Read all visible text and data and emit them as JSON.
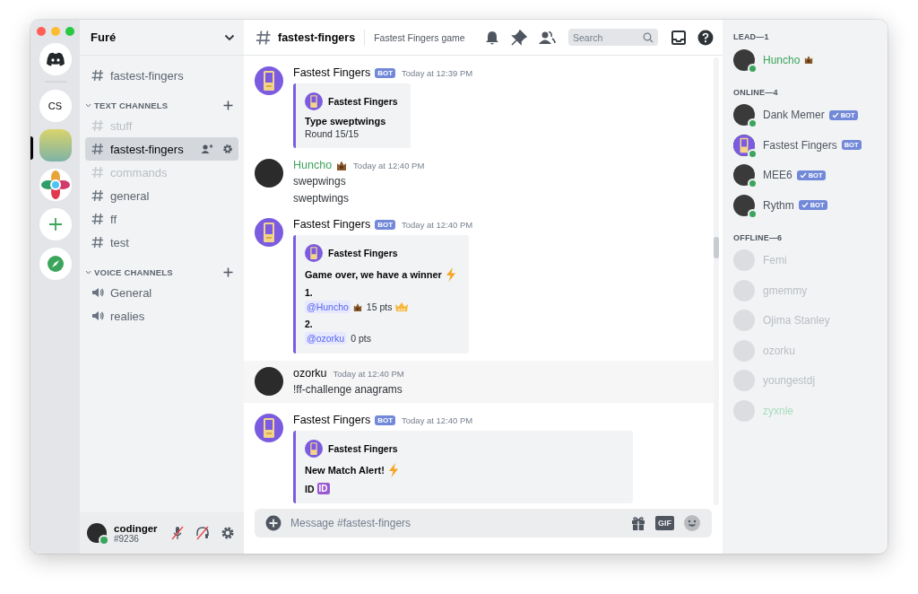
{
  "window": {
    "controls": [
      {
        "kind": "close"
      },
      {
        "kind": "minimize"
      },
      {
        "kind": "zoom"
      }
    ]
  },
  "servers": [
    {
      "kind": "logo",
      "selected": false
    },
    {
      "kind": "text",
      "label": "CS",
      "selected": false
    },
    {
      "kind": "photo",
      "selected": true
    },
    {
      "kind": "atom",
      "selected": false
    },
    {
      "kind": "add",
      "selected": false
    },
    {
      "kind": "explore",
      "selected": false
    }
  ],
  "server_name": "Furé",
  "pinned_channel": {
    "name": "fastest-fingers"
  },
  "categories": [
    {
      "label": "TEXT CHANNELS",
      "kind": "text",
      "channels": [
        {
          "name": "stuff",
          "selected": false,
          "muted": true
        },
        {
          "name": "fastest-fingers",
          "selected": true,
          "muted": false
        },
        {
          "name": "commands",
          "selected": false,
          "muted": true
        },
        {
          "name": "general",
          "selected": false,
          "muted": false
        },
        {
          "name": "ff",
          "selected": false,
          "muted": false
        },
        {
          "name": "test",
          "selected": false,
          "muted": false
        }
      ]
    },
    {
      "label": "VOICE CHANNELS",
      "kind": "voice",
      "channels": [
        {
          "name": "General",
          "selected": false,
          "muted": false
        },
        {
          "name": "realies",
          "selected": false,
          "muted": false
        }
      ]
    }
  ],
  "user": {
    "name": "codinger",
    "tag": "#9236",
    "online": true
  },
  "channel_header": {
    "name": "fastest-fingers",
    "topic": "Fastest Fingers game",
    "search": {
      "placeholder": "Search"
    }
  },
  "messages": [
    {
      "author": "Fastest Fingers",
      "color": "#060607",
      "emoji": false,
      "badge": "BOT",
      "time": "Today at 12:39 PM",
      "highlighted": false,
      "embed": {
        "author": "Fastest Fingers",
        "wide": false,
        "blocks": [
          {
            "kind": "title",
            "text": "Type sweptwings",
            "lightning": false
          },
          {
            "kind": "text",
            "text": "Round 15/15"
          }
        ]
      }
    },
    {
      "author": "Huncho",
      "color": "#3ba55c",
      "emoji": true,
      "time": "Today at 12:40 PM",
      "highlighted": false,
      "lines": [
        "swepwings",
        "sweptwings"
      ]
    },
    {
      "author": "Fastest Fingers",
      "color": "#060607",
      "emoji": false,
      "badge": "BOT",
      "time": "Today at 12:40 PM",
      "highlighted": false,
      "embed": {
        "author": "Fastest Fingers",
        "wide": false,
        "blocks": [
          {
            "kind": "title",
            "text": "Game over, we have a winner",
            "lightning": true
          },
          {
            "kind": "rank",
            "place": "1.",
            "mention": "@Huncho",
            "emoji": true,
            "points": "15 pts",
            "crown": true
          },
          {
            "kind": "rank",
            "place": "2.",
            "mention": "@ozorku",
            "emoji": false,
            "points": "0 pts",
            "crown": false
          }
        ]
      }
    },
    {
      "author": "ozorku",
      "color": "#060607",
      "emoji": false,
      "time": "Today at 12:40 PM",
      "highlighted": true,
      "lines": [
        "!ff-challenge anagrams"
      ]
    },
    {
      "author": "Fastest Fingers",
      "color": "#060607",
      "emoji": false,
      "badge": "BOT",
      "time": "Today at 12:40 PM",
      "highlighted": false,
      "embed": {
        "author": "Fastest Fingers",
        "wide": true,
        "blocks": [
          {
            "kind": "title",
            "text": "New Match Alert!",
            "lightning": true
          },
          {
            "kind": "id",
            "label": "ID",
            "badge": "ID"
          }
        ]
      }
    }
  ],
  "composer": {
    "placeholder": "Message #fastest-fingers",
    "gif_label": "GIF"
  },
  "member_groups": [
    {
      "label": "LEAD—1",
      "members": [
        {
          "name": "Huncho",
          "color": "#3ba55c",
          "emoji": true,
          "online": true
        }
      ]
    },
    {
      "label": "ONLINE—4",
      "members": [
        {
          "name": "Dank Memer",
          "color": "#4f5660",
          "badge": "BOT",
          "verified": true,
          "online": true
        },
        {
          "name": "Fastest Fingers",
          "color": "#4f5660",
          "badge": "BOT",
          "verified": false,
          "online": true
        },
        {
          "name": "MEE6",
          "color": "#4f5660",
          "badge": "BOT",
          "verified": true,
          "online": true
        },
        {
          "name": "Rythm",
          "color": "#4f5660",
          "badge": "BOT",
          "verified": true,
          "online": true
        }
      ]
    },
    {
      "label": "OFFLINE—6",
      "members": [
        {
          "name": "Femi",
          "color": "#b9bec4",
          "online": false
        },
        {
          "name": "gmemmy",
          "color": "#b9bec4",
          "online": false
        },
        {
          "name": "Ojima Stanley",
          "color": "#b9bec4",
          "online": false
        },
        {
          "name": "ozorku",
          "color": "#b9bec4",
          "online": false
        },
        {
          "name": "youngestdj",
          "color": "#b9bec4",
          "online": false
        },
        {
          "name": "zyxnle",
          "color": "#a8dcbc",
          "online": false
        }
      ]
    }
  ]
}
